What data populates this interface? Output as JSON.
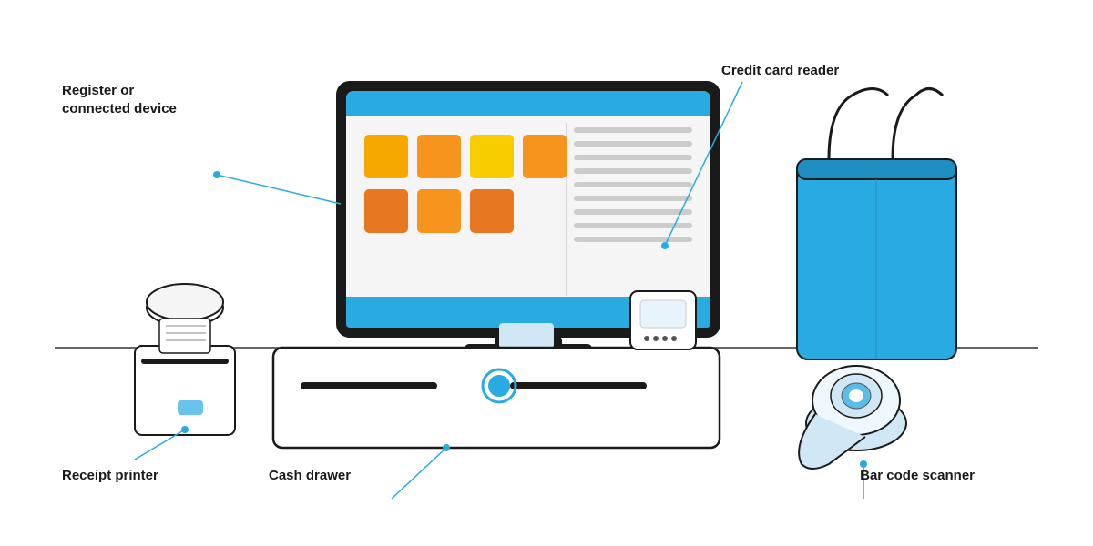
{
  "labels": {
    "register": "Register or\nconnected device",
    "credit_card": "Credit card reader",
    "receipt": "Receipt printer",
    "cash": "Cash drawer",
    "barcode": "Bar code scanner"
  },
  "colors": {
    "blue": "#29abe2",
    "dark": "#1a1a1a",
    "orange1": "#f7941d",
    "orange2": "#f7a800",
    "orange3": "#e87722",
    "line": "#2c2c2c",
    "bg": "#ffffff"
  }
}
